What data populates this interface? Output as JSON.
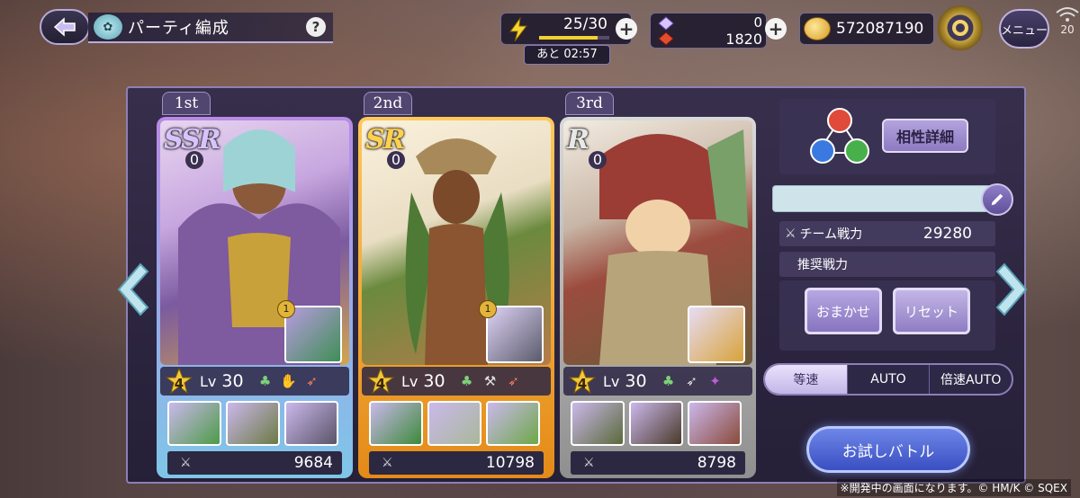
{
  "header": {
    "title": "パーティ編成",
    "help": "?",
    "stamina": {
      "value": "25/30",
      "fraction": 0.833,
      "timer": "あと 02:57"
    },
    "gems": {
      "free": "0",
      "paid": "1820"
    },
    "coins": "572087190",
    "menu_label": "メニュー",
    "signal_value": "20"
  },
  "party": [
    {
      "order": "1st",
      "rarity": "SSR",
      "rarity_level": "0",
      "rank": "4",
      "lv_label": "Lv",
      "level": "30",
      "sub_level": "1",
      "power": "9684"
    },
    {
      "order": "2nd",
      "rarity": "SR",
      "rarity_level": "0",
      "rank": "4",
      "lv_label": "Lv",
      "level": "30",
      "sub_level": "1",
      "power": "10798"
    },
    {
      "order": "3rd",
      "rarity": "R",
      "rarity_level": "0",
      "rank": "4",
      "lv_label": "Lv",
      "level": "30",
      "sub_level": "",
      "power": "8798"
    }
  ],
  "side": {
    "affinity_button": "相性詳細",
    "team_power_label": "チーム戦力",
    "team_power": "29280",
    "recommended_label": "推奨戦力",
    "recommended": "",
    "omakase": "おまかせ",
    "reset": "リセット",
    "speeds": [
      "等速",
      "AUTO",
      "倍速AUTO"
    ],
    "active_speed": "等速",
    "trial_battle": "お試しバトル"
  },
  "colors": {
    "ssr": "#b78be6",
    "sr": "#f0a830",
    "r": "#b5b5b5",
    "accent": "#8d7ac2"
  },
  "copyright": "※開発中の画面になります。© HM/K © SQEX"
}
